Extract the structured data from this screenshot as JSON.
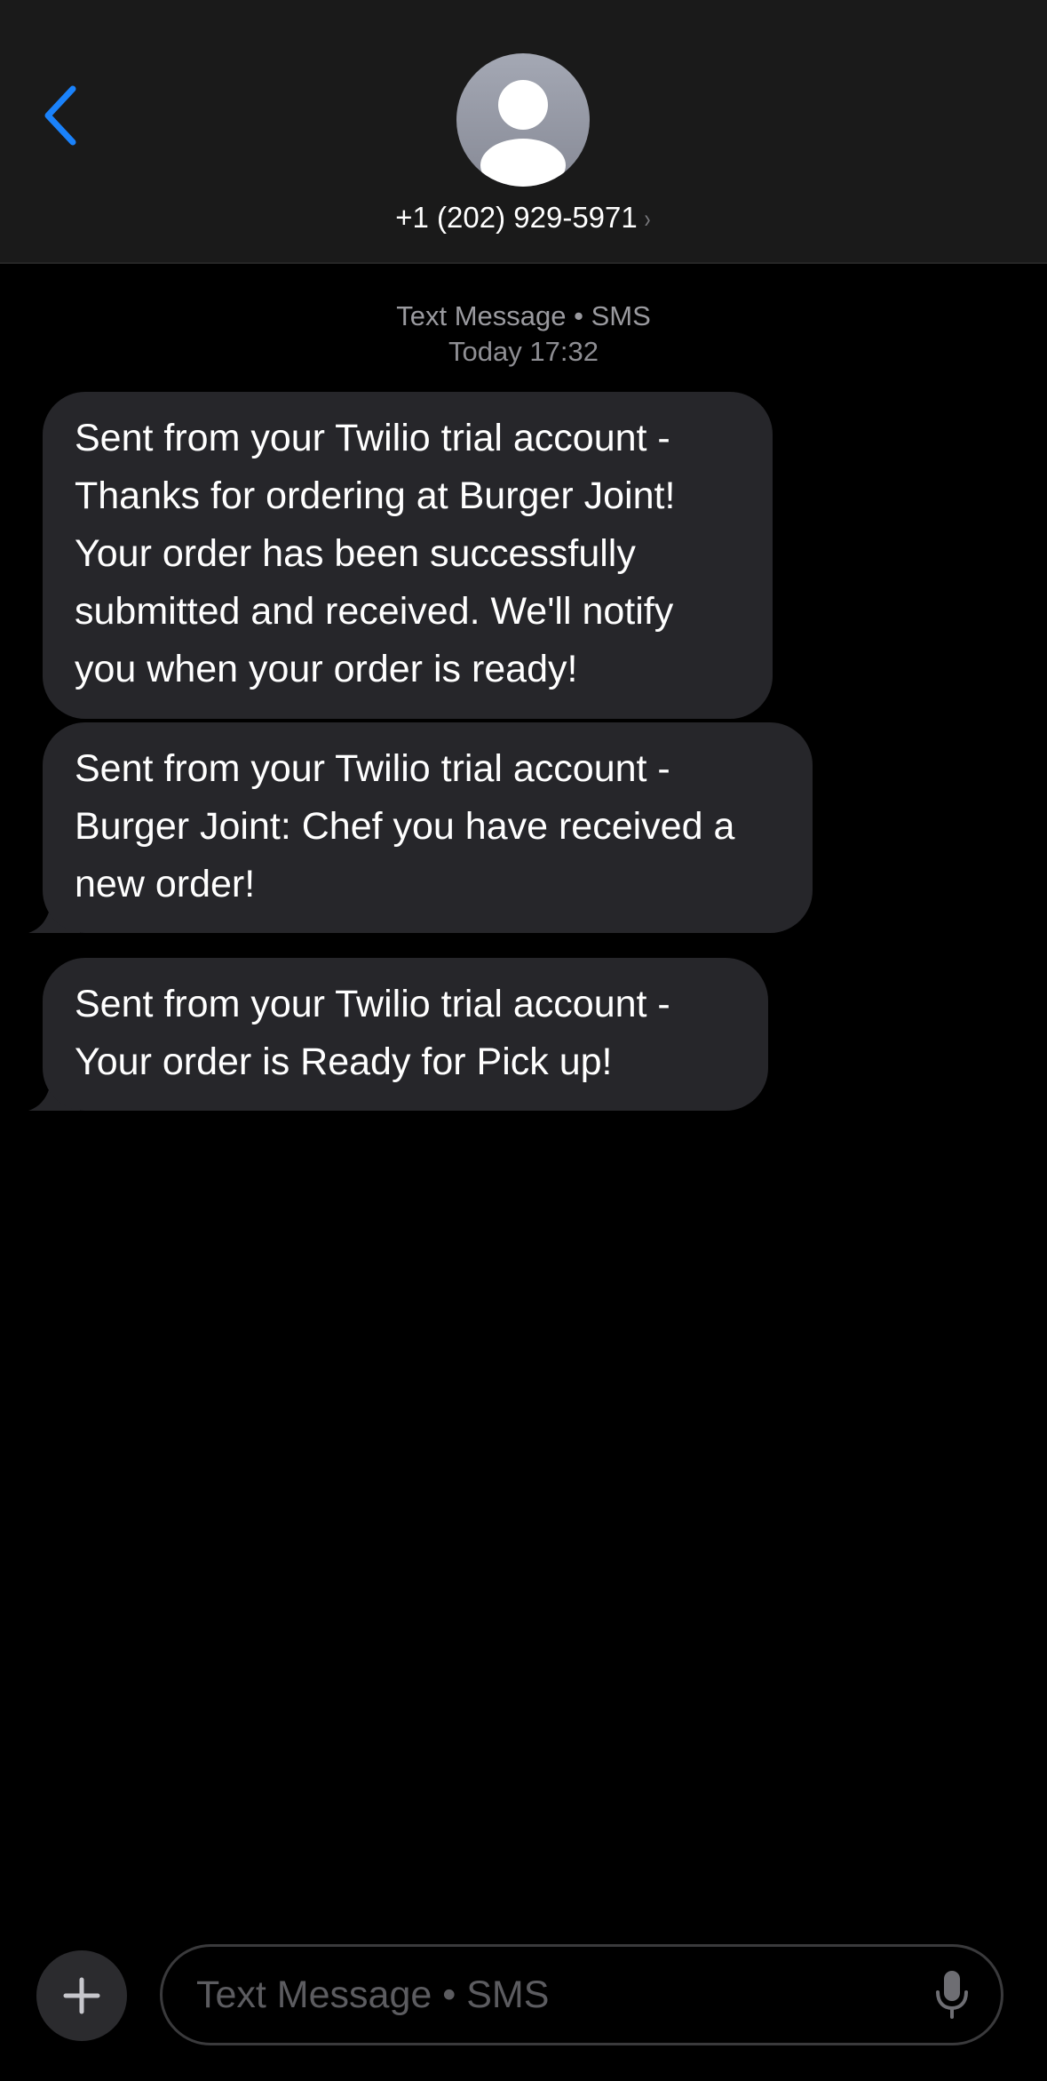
{
  "header": {
    "contact": "+1 (202) 929-5971",
    "chevron": "›"
  },
  "thread": {
    "service_line": "Text Message • SMS",
    "timestamp": "Today 17:32"
  },
  "messages": [
    {
      "text": "Sent from your Twilio trial account - Thanks for ordering at Burger Joint! Your order has been successfully submitted and received. We'll notify you when your order is ready!"
    },
    {
      "text": "Sent from your Twilio trial account - Burger Joint: Chef you have received a new order!"
    },
    {
      "text": "Sent from your Twilio trial account - Your order is Ready for Pick up!"
    }
  ],
  "composer": {
    "placeholder": "Text Message • SMS"
  },
  "icons": {
    "back": "chevron-left-icon",
    "avatar": "person-icon",
    "plus": "plus-icon",
    "mic": "microphone-icon"
  },
  "colors": {
    "accent": "#1a82fb",
    "bubble": "#26262a",
    "header": "#1a1a1a"
  }
}
